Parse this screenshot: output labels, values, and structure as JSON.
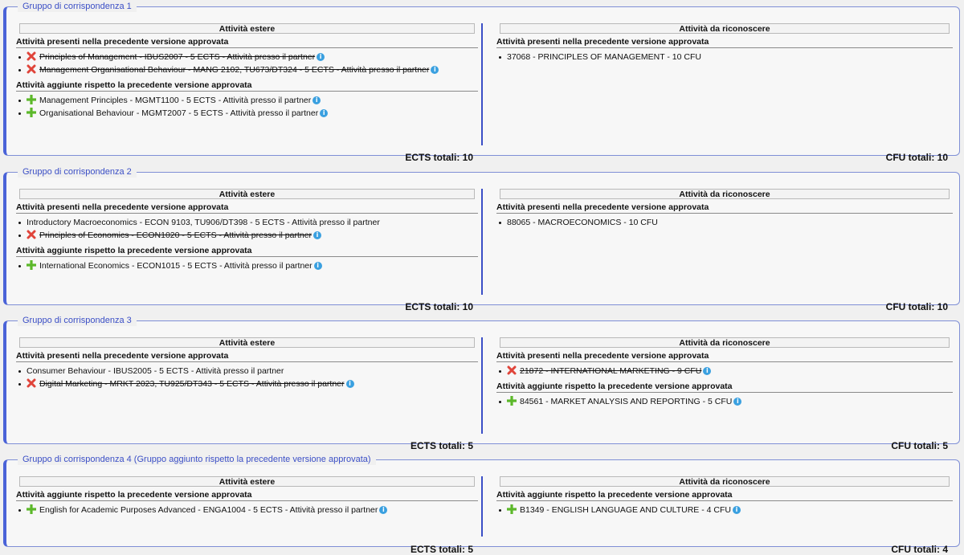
{
  "colors": {
    "accent": "#4a63d8",
    "legend": "#3b4fc6",
    "remove": "#e0443a",
    "add": "#5cb82a",
    "info": "#3aa0e0"
  },
  "icons": {
    "removed": "red-x-icon",
    "added": "green-plus-icon",
    "info": "info-icon"
  },
  "groups": [
    {
      "legend": "Gruppo di corrispondenza 1",
      "left": {
        "header": "Attività estere",
        "sections": [
          {
            "title": "Attività presenti nella precedente versione approvata",
            "items": [
              {
                "text": "Principles of Management - IBUS2007 - 5 ECTS - Attività presso il partner",
                "status": "removed",
                "info": true
              },
              {
                "text": "Management Organisational Behaviour - MANG 2102, TU673/DT324 - 5 ECTS - Attività presso il partner",
                "status": "removed",
                "info": true
              }
            ]
          },
          {
            "title": "Attività aggiunte rispetto la precedente versione approvata",
            "items": [
              {
                "text": "Management Principles - MGMT1100 - 5 ECTS - Attività presso il partner",
                "status": "added",
                "info": true
              },
              {
                "text": "Organisational Behaviour - MGMT2007 - 5 ECTS - Attività presso il partner",
                "status": "added",
                "info": true
              }
            ]
          }
        ],
        "total": "ECTS totali: 10"
      },
      "right": {
        "header": "Attività da riconoscere",
        "sections": [
          {
            "title": "Attività presenti nella precedente versione approvata",
            "items": [
              {
                "text": "37068 - PRINCIPLES OF MANAGEMENT - 10 CFU",
                "status": "normal",
                "info": false
              }
            ]
          }
        ],
        "total": "CFU totali: 10"
      }
    },
    {
      "legend": "Gruppo di corrispondenza 2",
      "left": {
        "header": "Attività estere",
        "sections": [
          {
            "title": "Attività presenti nella precedente versione approvata",
            "items": [
              {
                "text": "Introductory Macroeconomics - ECON 9103, TU906/DT398 - 5 ECTS - Attività presso il partner",
                "status": "normal",
                "info": false
              },
              {
                "text": "Principles of Economics - ECON1020 - 5 ECTS - Attività presso il partner",
                "status": "removed",
                "info": true
              }
            ]
          },
          {
            "title": "Attività aggiunte rispetto la precedente versione approvata",
            "items": [
              {
                "text": "International Economics - ECON1015 - 5 ECTS - Attività presso il partner",
                "status": "added",
                "info": true
              }
            ]
          }
        ],
        "total": "ECTS totali: 10"
      },
      "right": {
        "header": "Attività da riconoscere",
        "sections": [
          {
            "title": "Attività presenti nella precedente versione approvata",
            "items": [
              {
                "text": "88065 - MACROECONOMICS - 10 CFU",
                "status": "normal",
                "info": false
              }
            ]
          }
        ],
        "total": "CFU totali: 10"
      }
    },
    {
      "legend": "Gruppo di corrispondenza 3",
      "left": {
        "header": "Attività estere",
        "sections": [
          {
            "title": "Attività presenti nella precedente versione approvata",
            "items": [
              {
                "text": "Consumer Behaviour - IBUS2005 - 5 ECTS - Attività presso il partner",
                "status": "normal",
                "info": false
              },
              {
                "text": "Digital Marketing - MRKT 2023, TU925/DT343 - 5 ECTS - Attività presso il partner",
                "status": "removed",
                "info": true
              }
            ]
          }
        ],
        "total": "ECTS totali: 5"
      },
      "right": {
        "header": "Attività da riconoscere",
        "sections": [
          {
            "title": "Attività presenti nella precedente versione approvata",
            "items": [
              {
                "text": "21872 - INTERNATIONAL MARKETING - 9 CFU",
                "status": "removed",
                "info": true
              }
            ]
          },
          {
            "title": "Attività aggiunte rispetto la precedente versione approvata",
            "items": [
              {
                "text": "84561 - MARKET ANALYSIS AND REPORTING - 5 CFU",
                "status": "added",
                "info": true
              }
            ]
          }
        ],
        "total": "CFU totali: 5"
      }
    },
    {
      "legend": "Gruppo di corrispondenza 4 (Gruppo aggiunto rispetto la precedente versione approvata)",
      "left": {
        "header": "Attività estere",
        "sections": [
          {
            "title": "Attività aggiunte rispetto la precedente versione approvata",
            "items": [
              {
                "text": "English for Academic Purposes Advanced - ENGA1004 - 5 ECTS - Attività presso il partner",
                "status": "added",
                "info": true
              }
            ]
          }
        ],
        "total": "ECTS totali: 5"
      },
      "right": {
        "header": "Attività da riconoscere",
        "sections": [
          {
            "title": "Attività aggiunte rispetto la precedente versione approvata",
            "items": [
              {
                "text": "B1349 - ENGLISH LANGUAGE AND CULTURE - 4 CFU",
                "status": "added",
                "info": true
              }
            ]
          }
        ],
        "total": "CFU totali: 4"
      }
    }
  ]
}
